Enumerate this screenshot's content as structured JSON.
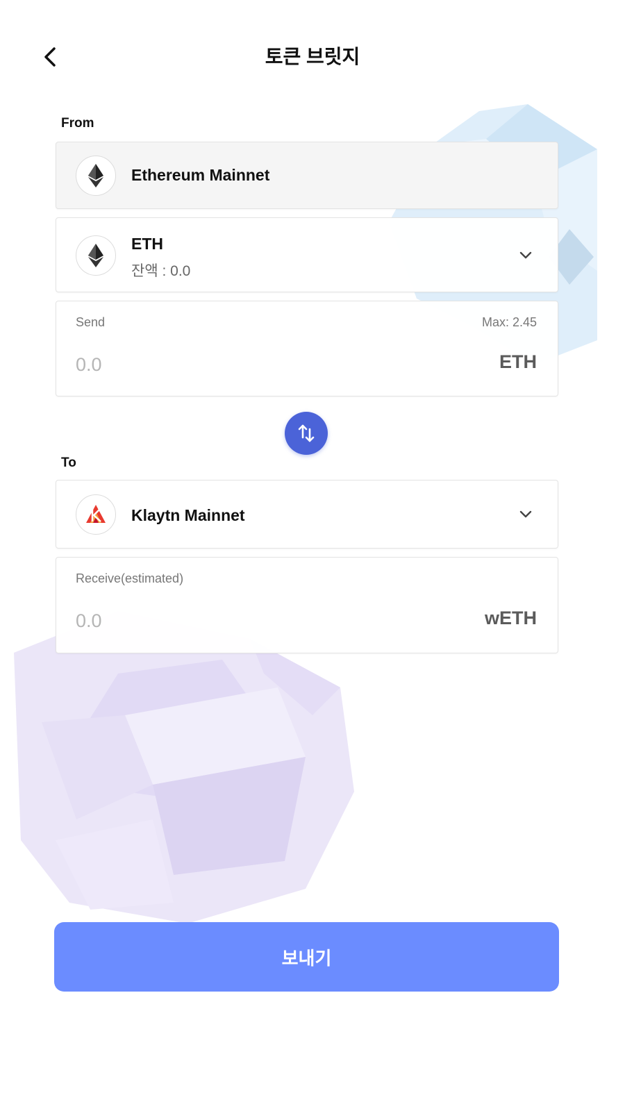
{
  "header": {
    "title": "토큰 브릿지"
  },
  "from": {
    "section_label": "From",
    "network": {
      "name": "Ethereum Mainnet",
      "icon": "ethereum-icon"
    },
    "token": {
      "symbol": "ETH",
      "balance_label": "잔액 : 0.0",
      "icon": "ethereum-icon"
    },
    "send": {
      "label": "Send",
      "max_label": "Max: 2.45",
      "placeholder": "0.0",
      "unit": "ETH"
    }
  },
  "swap": {
    "icon": "swap-arrows-icon"
  },
  "to": {
    "section_label": "To",
    "network": {
      "name": "Klaytn Mainnet",
      "icon": "klaytn-icon"
    },
    "receive": {
      "label": "Receive(estimated)",
      "placeholder": "0.0",
      "unit": "wETH"
    }
  },
  "actions": {
    "send_label": "보내기"
  },
  "colors": {
    "accent": "#4b63d8",
    "primary_button": "#6b8cff"
  }
}
